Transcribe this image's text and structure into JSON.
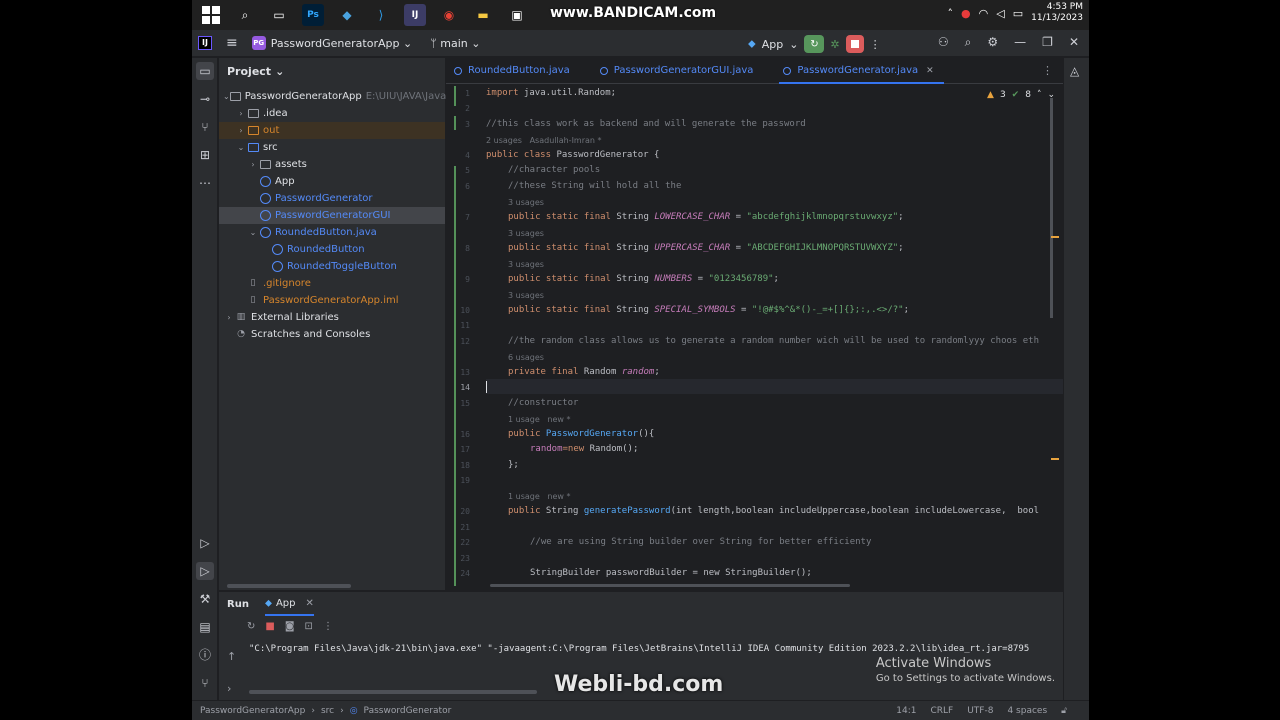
{
  "taskbar": {
    "recorder_text": "www.BANDICAM.com",
    "time": "4:53 PM",
    "date": "11/13/2023"
  },
  "titlebar": {
    "project_badge": "PG",
    "project_name": "PasswordGeneratorApp",
    "branch": "main",
    "run_config": "App"
  },
  "project_panel": {
    "title": "Project",
    "root_name": "PasswordGeneratorApp",
    "root_path": "E:\\UIU\\JAVA\\Java_n",
    "items": [
      {
        "label": ".idea"
      },
      {
        "label": "out"
      },
      {
        "label": "src"
      },
      {
        "label": "assets"
      },
      {
        "label": "App"
      },
      {
        "label": "PasswordGenerator"
      },
      {
        "label": "PasswordGeneratorGUI"
      },
      {
        "label": "RoundedButton.java"
      },
      {
        "label": "RoundedButton"
      },
      {
        "label": "RoundedToggleButton"
      },
      {
        "label": ".gitignore"
      },
      {
        "label": "PasswordGeneratorApp.iml"
      },
      {
        "label": "External Libraries"
      },
      {
        "label": "Scratches and Consoles"
      }
    ]
  },
  "editor": {
    "tabs": [
      {
        "label": "RoundedButton.java"
      },
      {
        "label": "PasswordGeneratorGUI.java"
      },
      {
        "label": "PasswordGenerator.java"
      }
    ],
    "warnings": "3",
    "checks": "8",
    "code": {
      "l1_import": "import",
      "l1_rest": " java.util.Random;",
      "l3": "//this class work as backend and will generate the password",
      "h_class": "2 usages   Asadullah-Imran *",
      "l4_kw": "public class",
      "l4_rest": " PasswordGenerator {",
      "l5": "//character pools",
      "l6": "//these String will hold all the",
      "h3a": "3 usages",
      "l7_kw": "public static final",
      "l7_type": " String ",
      "l7_name": "LOWERCASE_CHAR",
      "l7_eq": " = ",
      "l7_val": "\"abcdefghijklmnopqrstuvwxyz\"",
      "l7_end": ";",
      "h3b": "3 usages",
      "l8_name": "UPPERCASE_CHAR",
      "l8_val": "\"ABCDEFGHIJKLMNOPQRSTUVWXYZ\"",
      "h3c": "3 usages",
      "l9_name": "NUMBERS",
      "l9_val": "\"0123456789\"",
      "h3d": "3 usages",
      "l10_name": "SPECIAL_SYMBOLS",
      "l10_val": "\"!@#$%^&*()-_=+[]{};:,.<>/?\"",
      "l12": "//the random class allows us to generate a random number wich will be used to randomlyyy choos eth",
      "h6": "6 usages",
      "l13_kw": "private final",
      "l13_type": " Random ",
      "l13_name": "random",
      "l15": "//constructor",
      "h_ctor": "1 usage   new *",
      "l16_kw": "public",
      "l16_fn": " PasswordGenerator",
      "l16_end": "(){",
      "l17_name": "random",
      "l17_kw": "=new",
      "l17_end": " Random();",
      "l18": "};",
      "h_gen": "1 usage   new *",
      "l20_kw": "public",
      "l20_type": " String ",
      "l20_fn": "generatePassword",
      "l20_args": "(int length,boolean includeUppercase,boolean includeLowercase,  bool",
      "l22": "//we are using String builder over String for better efficienty",
      "l24": "StringBuilder passwordBuilder = new StringBuilder();"
    },
    "line_numbers": [
      "1",
      "2",
      "3",
      "4",
      "5",
      "6",
      "7",
      "8",
      "9",
      "10",
      "11",
      "12",
      "13",
      "14",
      "15",
      "16",
      "17",
      "18",
      "19",
      "20",
      "21",
      "22",
      "23",
      "24"
    ]
  },
  "run_panel": {
    "run_label": "Run",
    "app_tab": "App",
    "console_line": "\"C:\\Program Files\\Java\\jdk-21\\bin\\java.exe\" \"-javaagent:C:\\Program Files\\JetBrains\\IntelliJ IDEA Community Edition 2023.2.2\\lib\\idea_rt.jar=8795",
    "activate_title": "Activate Windows",
    "activate_sub": "Go to Settings to activate Windows."
  },
  "watermark": "Webli-bd.com",
  "statusbar": {
    "crumb1": "PasswordGeneratorApp",
    "crumb2": "src",
    "crumb3": "PasswordGenerator",
    "position": "14:1",
    "line_sep": "CRLF",
    "encoding": "UTF-8",
    "indent": "4 spaces"
  },
  "colors": {
    "accent": "#3574f0",
    "run_green": "#57965c",
    "stop_red": "#db5c5c",
    "string_green": "#6aab73",
    "keyword_orange": "#cf8e6d",
    "constant_purple": "#c77dbb"
  }
}
